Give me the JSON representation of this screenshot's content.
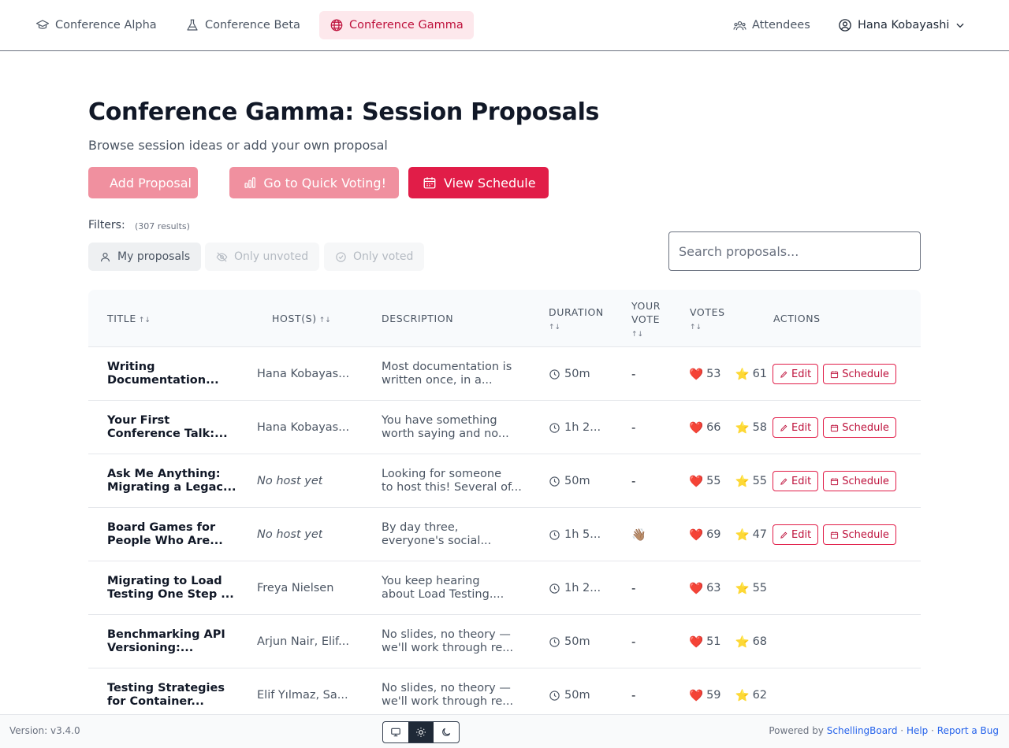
{
  "nav": {
    "tabs": [
      {
        "label": "Conference Alpha",
        "icon": "graduation-cap-icon"
      },
      {
        "label": "Conference Beta",
        "icon": "flask-icon"
      },
      {
        "label": "Conference Gamma",
        "icon": "globe-icon",
        "active": true
      }
    ],
    "attendees_label": "Attendees",
    "user_name": "Hana Kobayashi"
  },
  "header": {
    "title": "Conference Gamma: Session Proposals",
    "subtitle": "Browse session ideas or add your own proposal"
  },
  "actions": {
    "add_proposal": "Add Proposal",
    "quick_voting": "Go to Quick Voting!",
    "view_schedule": "View Schedule"
  },
  "filters": {
    "label": "Filters:",
    "count": "(307 results)",
    "my_proposals": "My proposals",
    "only_unvoted": "Only unvoted",
    "only_voted": "Only voted"
  },
  "search": {
    "placeholder": "Search proposals..."
  },
  "table": {
    "headers": {
      "title": "Title",
      "hosts": "Host(s)",
      "description": "Description",
      "duration": "Duration",
      "your_vote_1": "Your",
      "your_vote_2": "Vote",
      "votes": "Votes",
      "actions": "Actions",
      "sort_symbol": "↑↓"
    },
    "edit_label": "Edit",
    "schedule_label": "Schedule",
    "rows": [
      {
        "title_1": "Writing",
        "title_2": "Documentation...",
        "host": "Hana Kobayas...",
        "desc_1": "Most documentation is",
        "desc_2": "written once, in a...",
        "duration": "50m",
        "vote": "-",
        "hearts": "53",
        "stars": "61"
      },
      {
        "title_1": "Your First",
        "title_2": "Conference Talk:...",
        "host": "Hana Kobayas...",
        "desc_1": "You have something",
        "desc_2": "worth saying and no...",
        "duration": "1h 2...",
        "vote": "-",
        "hearts": "66",
        "stars": "58"
      },
      {
        "title_1": "Ask Me Anything:",
        "title_2": "Migrating a Legac...",
        "host": "No host yet",
        "desc_1": "Looking for someone",
        "desc_2": "to host this! Several of...",
        "duration": "50m",
        "vote": "-",
        "hearts": "55",
        "stars": "55"
      },
      {
        "title_1": "Board Games for",
        "title_2": "People Who Are...",
        "host": "No host yet",
        "desc_1": "By day three,",
        "desc_2": "everyone's social...",
        "duration": "1h 5...",
        "vote": "👋🏽",
        "hearts": "69",
        "stars": "47"
      },
      {
        "title_1": "Migrating to Load",
        "title_2": "Testing One Step ...",
        "host": "Freya Nielsen",
        "desc_1": "You keep hearing",
        "desc_2": "about Load Testing....",
        "duration": "1h 2...",
        "vote": "-",
        "hearts": "63",
        "stars": "55"
      },
      {
        "title_1": "Benchmarking API",
        "title_2": "Versioning:...",
        "host": "Arjun Nair, Elif...",
        "desc_1": "No slides, no theory —",
        "desc_2": "we'll work through re...",
        "duration": "50m",
        "vote": "-",
        "hearts": "51",
        "stars": "68"
      },
      {
        "title_1": "Testing Strategies",
        "title_2": "for Container...",
        "host": "Elif Yılmaz, Sa...",
        "desc_1": "No slides, no theory —",
        "desc_2": "we'll work through re...",
        "duration": "50m",
        "vote": "-",
        "hearts": "59",
        "stars": "62"
      }
    ]
  },
  "footer": {
    "version": "Version: v3.4.0",
    "powered_by": "Powered by",
    "brand": "SchellingBoard",
    "sep": "·",
    "help": "Help",
    "report": "Report a Bug"
  },
  "colors": {
    "accent": "#e11d48",
    "accent_light": "#f0909f",
    "active_tab_bg": "#fde8ec"
  }
}
